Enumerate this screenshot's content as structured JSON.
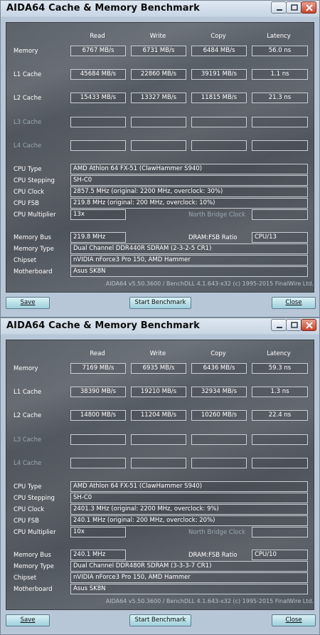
{
  "windows": [
    {
      "title": "AIDA64 Cache & Memory Benchmark",
      "headers": [
        "Read",
        "Write",
        "Copy",
        "Latency"
      ],
      "rows": [
        {
          "label": "Memory",
          "read": "6767 MB/s",
          "write": "6731 MB/s",
          "copy": "6484 MB/s",
          "latency": "56.0 ns"
        },
        {
          "label": "L1 Cache",
          "read": "45684 MB/s",
          "write": "22860 MB/s",
          "copy": "39191 MB/s",
          "latency": "1.1 ns"
        },
        {
          "label": "L2 Cache",
          "read": "15433 MB/s",
          "write": "13327 MB/s",
          "copy": "11815 MB/s",
          "latency": "21.3 ns"
        },
        {
          "label": "L3 Cache",
          "read": "",
          "write": "",
          "copy": "",
          "latency": ""
        },
        {
          "label": "L4 Cache",
          "read": "",
          "write": "",
          "copy": "",
          "latency": ""
        }
      ],
      "cpu": {
        "type_label": "CPU Type",
        "type": "AMD Athlon 64 FX-51  (ClawHammer S940)",
        "stepping_label": "CPU Stepping",
        "stepping": "SH-C0",
        "clock_label": "CPU Clock",
        "clock": "2857.5 MHz  (original: 2200 MHz, overclock: 30%)",
        "fsb_label": "CPU FSB",
        "fsb": "219.8 MHz  (original: 200 MHz, overclock: 10%)",
        "mult_label": "CPU Multiplier",
        "mult": "13x",
        "nb_label": "North Bridge Clock",
        "nb": ""
      },
      "mem": {
        "bus_label": "Memory Bus",
        "bus": "219.8 MHz",
        "ratio_label": "DRAM:FSB Ratio",
        "ratio": "CPU/13",
        "type_label": "Memory Type",
        "type": "Dual Channel DDR440R SDRAM  (2-3-2-5 CR1)",
        "chipset_label": "Chipset",
        "chipset": "nVIDIA nForce3 Pro 150, AMD Hammer",
        "mobo_label": "Motherboard",
        "mobo": "Asus SK8N"
      },
      "footer": "AIDA64 v5.50.3600 / BenchDLL 4.1.643-x32  (c) 1995-2015 FinalWire Ltd.",
      "buttons": {
        "save": "Save",
        "start": "Start Benchmark",
        "close": "Close"
      }
    },
    {
      "title": "AIDA64 Cache & Memory Benchmark",
      "headers": [
        "Read",
        "Write",
        "Copy",
        "Latency"
      ],
      "rows": [
        {
          "label": "Memory",
          "read": "7169 MB/s",
          "write": "6935 MB/s",
          "copy": "6436 MB/s",
          "latency": "59.3 ns"
        },
        {
          "label": "L1 Cache",
          "read": "38390 MB/s",
          "write": "19210 MB/s",
          "copy": "32934 MB/s",
          "latency": "1.3 ns"
        },
        {
          "label": "L2 Cache",
          "read": "14800 MB/s",
          "write": "11204 MB/s",
          "copy": "10260 MB/s",
          "latency": "22.4 ns"
        },
        {
          "label": "L3 Cache",
          "read": "",
          "write": "",
          "copy": "",
          "latency": ""
        },
        {
          "label": "L4 Cache",
          "read": "",
          "write": "",
          "copy": "",
          "latency": ""
        }
      ],
      "cpu": {
        "type_label": "CPU Type",
        "type": "AMD Athlon 64 FX-51  (ClawHammer S940)",
        "stepping_label": "CPU Stepping",
        "stepping": "SH-C0",
        "clock_label": "CPU Clock",
        "clock": "2401.3 MHz  (original: 2200 MHz, overclock: 9%)",
        "fsb_label": "CPU FSB",
        "fsb": "240.1 MHz  (original: 200 MHz, overclock: 20%)",
        "mult_label": "CPU Multiplier",
        "mult": "10x",
        "nb_label": "North Bridge Clock",
        "nb": ""
      },
      "mem": {
        "bus_label": "Memory Bus",
        "bus": "240.1 MHz",
        "ratio_label": "DRAM:FSB Ratio",
        "ratio": "CPU/10",
        "type_label": "Memory Type",
        "type": "Dual Channel DDR480R SDRAM  (3-3-3-7 CR1)",
        "chipset_label": "Chipset",
        "chipset": "nVIDIA nForce3 Pro 150, AMD Hammer",
        "mobo_label": "Motherboard",
        "mobo": "Asus SK8N"
      },
      "footer": "AIDA64 v5.50.3600 / BenchDLL 4.1.643-x32  (c) 1995-2015 FinalWire Ltd.",
      "buttons": {
        "save": "Save",
        "start": "Start Benchmark",
        "close": "Close"
      }
    }
  ]
}
